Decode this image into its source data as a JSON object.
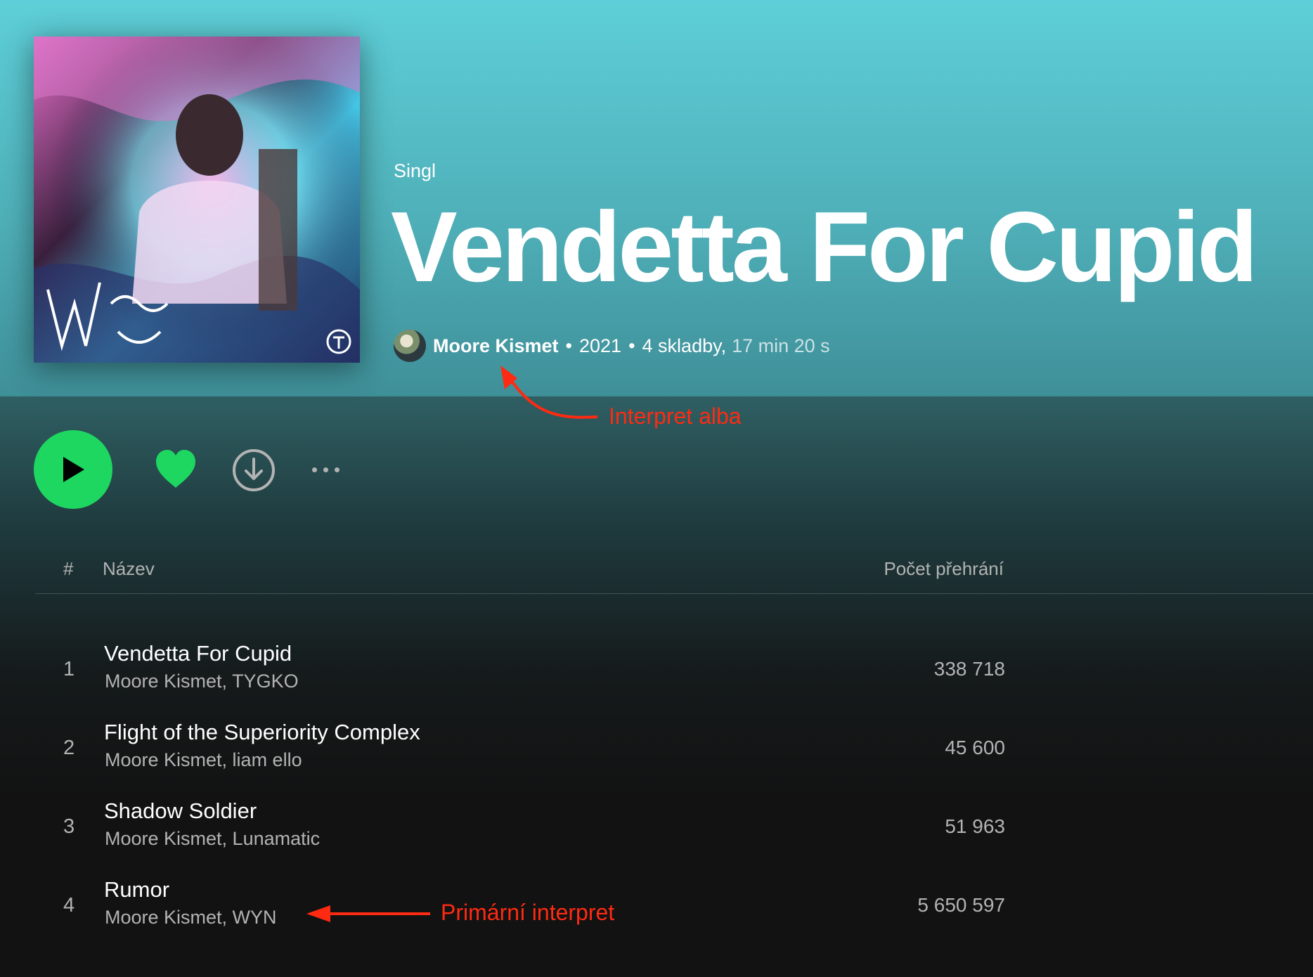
{
  "album": {
    "type": "Singl",
    "title": "Vendetta For Cupid",
    "artist": "Moore Kismet",
    "separator": "•",
    "year": "2021",
    "tracks_count": "4 skladby,",
    "duration": "17 min 20 s",
    "cover_icon": "album-cover-art",
    "avatar_icon": "artist-avatar"
  },
  "controls": {
    "play_icon": "play-icon",
    "like_icon": "heart-icon",
    "download_icon": "download-icon",
    "more_icon": "more-icon"
  },
  "table": {
    "col_number": "#",
    "col_title": "Název",
    "col_plays": "Počet přehrání"
  },
  "tracks": [
    {
      "number": "1",
      "title": "Vendetta For Cupid",
      "artists": "Moore Kismet, TYGKO",
      "plays": "338 718"
    },
    {
      "number": "2",
      "title": "Flight of the Superiority Complex",
      "artists": "Moore Kismet, liam ello",
      "plays": "45 600"
    },
    {
      "number": "3",
      "title": "Shadow Soldier",
      "artists": "Moore Kismet, Lunamatic",
      "plays": "51 963"
    },
    {
      "number": "4",
      "title": "Rumor",
      "artists": "Moore Kismet, WYN",
      "plays": "5 650 597"
    }
  ],
  "annotations": {
    "album_artist": "Interpret alba",
    "primary_artist": "Primární interpret",
    "color": "#ff2a12"
  },
  "colors": {
    "accent_green": "#1ed760",
    "hero_top": "#5ecfd8",
    "background": "#121212",
    "muted_text": "#b3b3b3"
  }
}
